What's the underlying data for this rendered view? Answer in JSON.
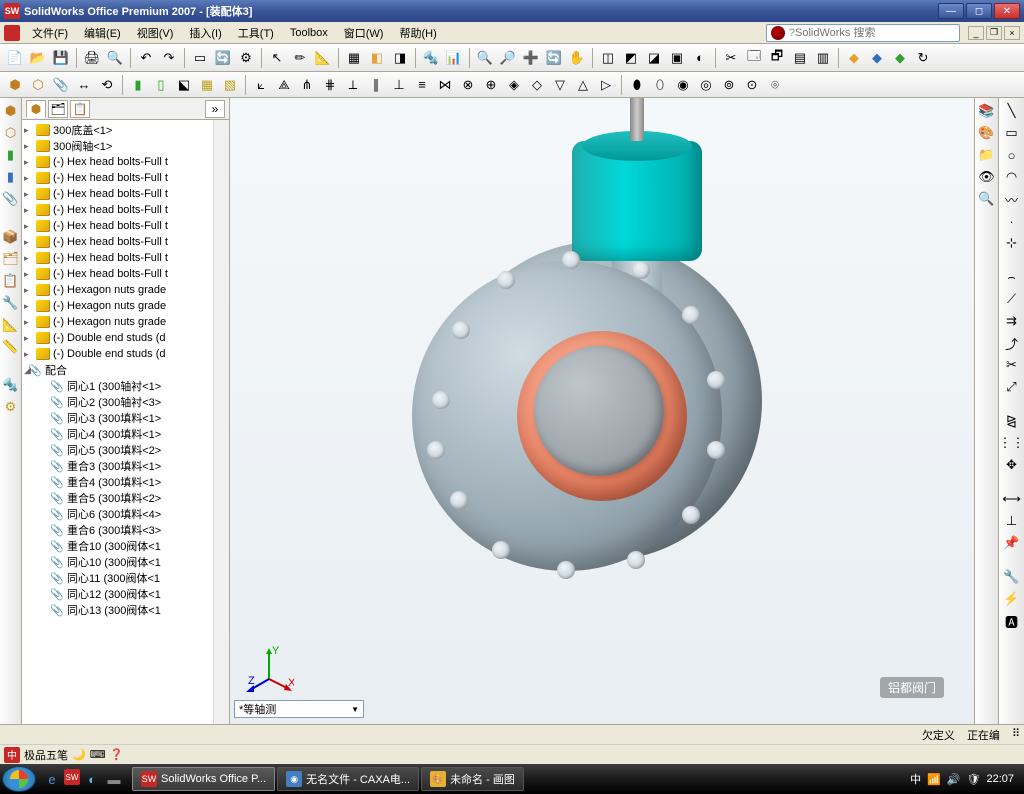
{
  "titlebar": {
    "title": "SolidWorks Office Premium 2007 - [装配体3]"
  },
  "menu": {
    "items": [
      "文件(F)",
      "编辑(E)",
      "视图(V)",
      "插入(I)",
      "工具(T)",
      "Toolbox",
      "窗口(W)",
      "帮助(H)"
    ],
    "search_placeholder": "SolidWorks 搜索"
  },
  "tree": {
    "parts": [
      "300底盖<1>",
      "300阀轴<1>",
      "(-) Hex head bolts-Full t",
      "(-) Hex head bolts-Full t",
      "(-) Hex head bolts-Full t",
      "(-) Hex head bolts-Full t",
      "(-) Hex head bolts-Full t",
      "(-) Hex head bolts-Full t",
      "(-) Hex head bolts-Full t",
      "(-) Hex head bolts-Full t",
      "(-) Hexagon nuts grade",
      "(-) Hexagon nuts grade",
      "(-) Hexagon nuts grade",
      "(-) Double end studs (d",
      "(-) Double end studs (d"
    ],
    "mates_label": "配合",
    "mates": [
      "同心1 (300轴衬<1>",
      "同心2 (300轴衬<3>",
      "同心3 (300填料<1>",
      "同心4 (300填料<1>",
      "同心5 (300填料<2>",
      "重合3 (300填料<1>",
      "重合4 (300填料<1>",
      "重合5 (300填料<2>",
      "同心6 (300填料<4>",
      "重合6 (300填料<3>",
      "重合10 (300阀体<1",
      "同心10 (300阀体<1",
      "同心11 (300阀体<1",
      "同心12 (300阀体<1",
      "同心13 (300阀体<1"
    ]
  },
  "view_selector": "*等轴测",
  "status": {
    "left": "",
    "r1": "欠定义",
    "r2": "正在编",
    "r3": ""
  },
  "ime": {
    "label": "极品五笔"
  },
  "taskbar": {
    "items": [
      {
        "label": "SolidWorks Office P...",
        "active": true
      },
      {
        "label": "无名文件 - CAXA电...",
        "active": false
      },
      {
        "label": "未命名 - 画图",
        "active": false
      }
    ],
    "time": "22:07"
  },
  "watermark": "铝都阀门"
}
